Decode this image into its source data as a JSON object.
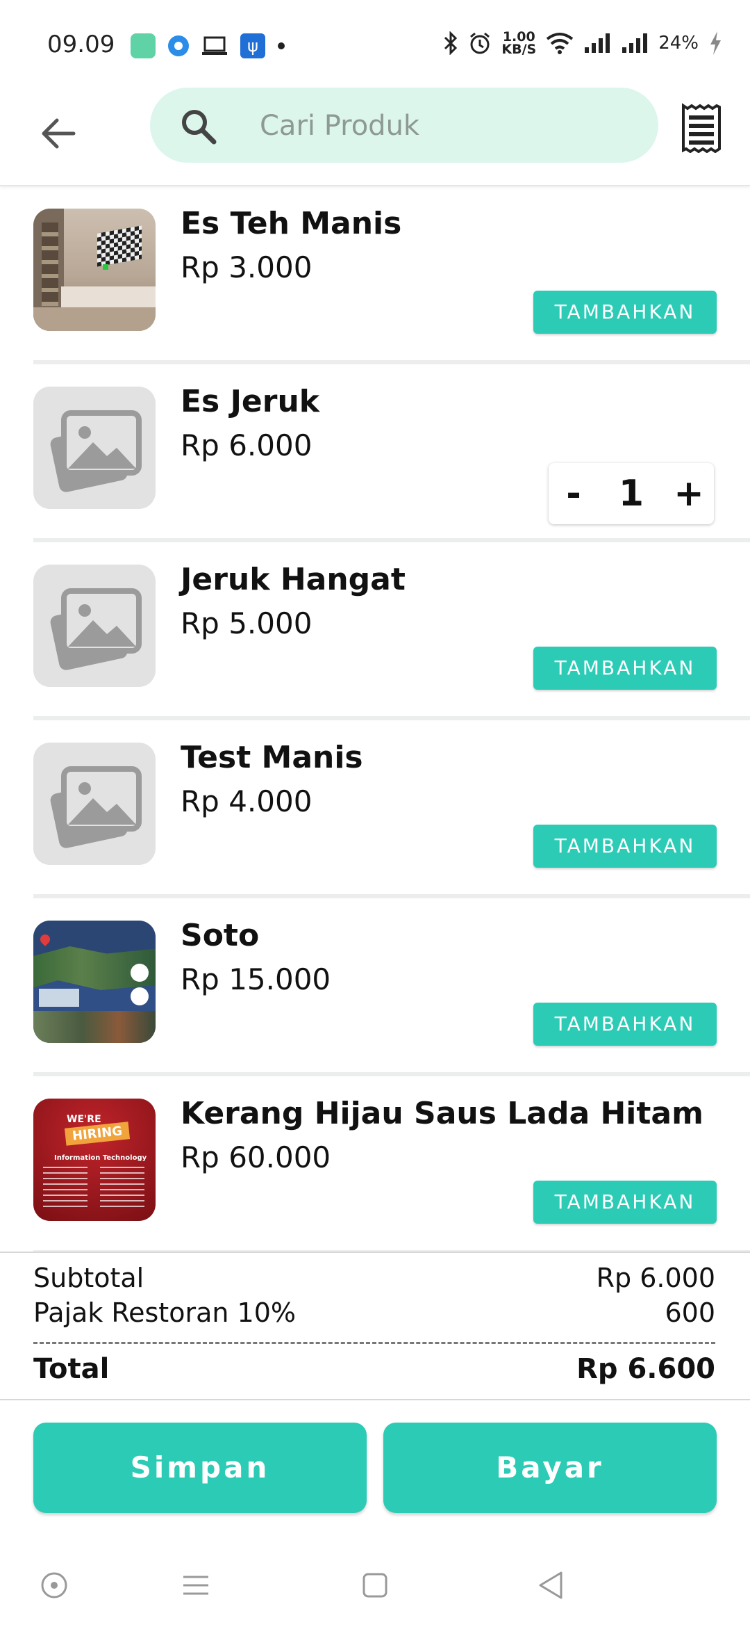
{
  "status_bar": {
    "time": "09.09",
    "net_speed_value": "1.00",
    "net_speed_unit": "KB/S",
    "battery": "24%"
  },
  "search": {
    "placeholder": "Cari Produk",
    "value": ""
  },
  "products": [
    {
      "name": "Es Teh Manis",
      "price": "Rp 3.000",
      "action": "TAMBAHKAN",
      "thumb": "room-photo"
    },
    {
      "name": "Es Jeruk",
      "price": "Rp 6.000",
      "quantity": "1",
      "minus": "-",
      "plus": "+",
      "thumb": "image-placeholder-icon"
    },
    {
      "name": "Jeruk Hangat",
      "price": "Rp 5.000",
      "action": "TAMBAHKAN",
      "thumb": "image-placeholder-icon"
    },
    {
      "name": "Test Manis",
      "price": "Rp 4.000",
      "action": "TAMBAHKAN",
      "thumb": "image-placeholder-icon"
    },
    {
      "name": "Soto",
      "price": "Rp 15.000",
      "action": "TAMBAHKAN",
      "thumb": "map-photo"
    },
    {
      "name": "Kerang Hijau Saus Lada Hitam",
      "price": "Rp 60.000",
      "action": "TAMBAHKAN",
      "thumb": "hiring-poster",
      "poster_text_1": "WE'RE",
      "poster_text_2": "HIRING",
      "poster_text_3": "Information Technology"
    }
  ],
  "summary": {
    "subtotal_label": "Subtotal",
    "subtotal_value": "Rp 6.000",
    "tax_label": "Pajak Restoran 10%",
    "tax_value": "600",
    "total_label": "Total",
    "total_value": "Rp 6.600"
  },
  "actions": {
    "save": "Simpan",
    "pay": "Bayar"
  },
  "colors": {
    "accent": "#2ccbb6",
    "search_bg": "#dcf6ec",
    "placeholder_bg": "#e2e2e2"
  }
}
